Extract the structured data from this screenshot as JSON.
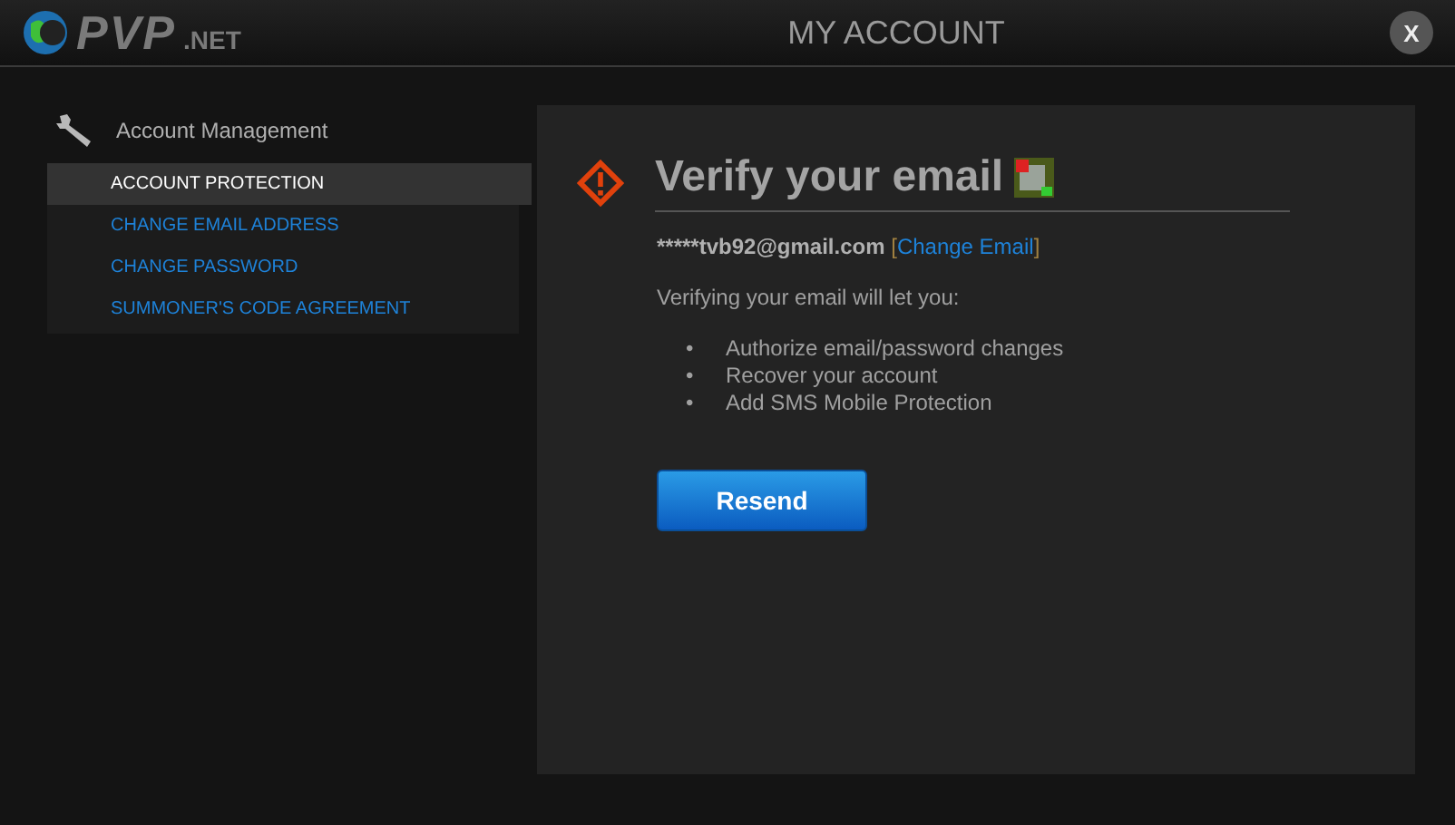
{
  "logo": {
    "main": "PVP",
    "suffix": ".NET"
  },
  "window": {
    "title": "MY ACCOUNT",
    "close": "X"
  },
  "sidebar": {
    "header": "Account Management",
    "items": [
      {
        "label": "ACCOUNT PROTECTION",
        "selected": true
      },
      {
        "label": "CHANGE EMAIL ADDRESS",
        "selected": false
      },
      {
        "label": "CHANGE PASSWORD",
        "selected": false
      },
      {
        "label": "SUMMONER'S CODE AGREEMENT",
        "selected": false
      }
    ]
  },
  "content": {
    "heading": "Verify your email",
    "email": "*****tvb92@gmail.com",
    "link_open": "[",
    "change_link": "Change Email",
    "link_close": "]",
    "bullet": "•",
    "intro": "Verifying your email will let you:",
    "benefits": [
      "Authorize email/password changes",
      "Recover your account",
      "Add SMS Mobile Protection"
    ],
    "button": "Resend"
  }
}
